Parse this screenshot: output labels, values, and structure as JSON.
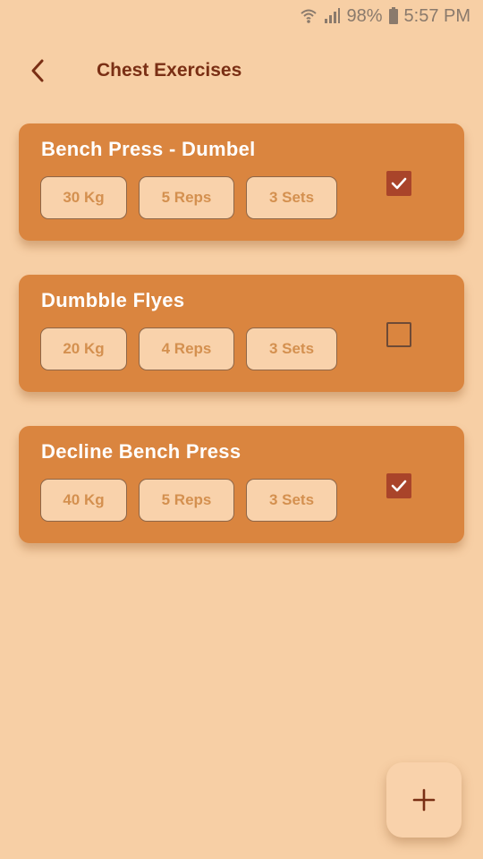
{
  "status_bar": {
    "battery": "98%",
    "time": "5:57 PM",
    "icons": [
      "wifi-icon",
      "signal-icon",
      "battery-icon"
    ]
  },
  "header": {
    "title": "Chest Exercises",
    "back_icon": "back-arrow-icon"
  },
  "exercises": [
    {
      "name": "Bench Press - Dumbel",
      "weight": "30 Kg",
      "reps": "5 Reps",
      "sets": "3 Sets",
      "checked": true
    },
    {
      "name": "Dumbble Flyes",
      "weight": "20 Kg",
      "reps": "4 Reps",
      "sets": "3 Sets",
      "checked": false
    },
    {
      "name": "Decline Bench Press",
      "weight": "40 Kg",
      "reps": "5 Reps",
      "sets": "3 Sets",
      "checked": true
    }
  ],
  "fab": {
    "icon": "plus-icon"
  },
  "colors": {
    "background": "#f7cfa5",
    "card": "#da853f",
    "pill": "#f9d2ab",
    "pill_text": "#d4904f",
    "title": "#7a2f14",
    "checkbox_on": "#a9442a"
  }
}
